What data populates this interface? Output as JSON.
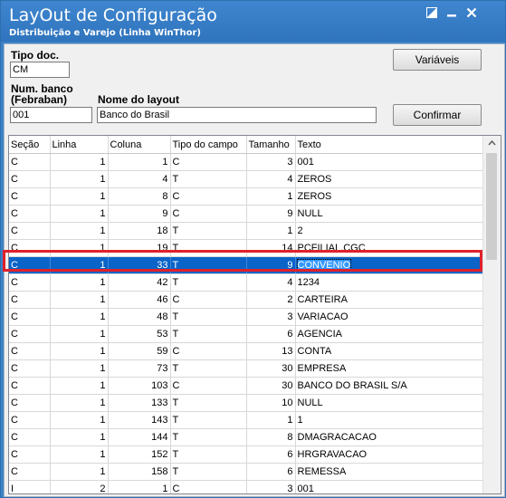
{
  "window": {
    "title": "LayOut de Configuração",
    "subtitle": "Distribuição e Varejo (Linha WinThor)"
  },
  "form": {
    "tipo_doc_label": "Tipo doc.",
    "tipo_doc_value": "CM",
    "num_banco_label_1": "Num. banco",
    "num_banco_label_2": "(Febraban)",
    "num_banco_value": "001",
    "nome_layout_label": "Nome do layout",
    "nome_layout_value": "Banco do Brasil",
    "variaveis_button": "Variáveis",
    "confirmar_button": "Confirmar"
  },
  "grid": {
    "columns": [
      "Seção",
      "Linha",
      "Coluna",
      "Tipo do campo",
      "Tamanho",
      "Texto"
    ],
    "selected_row": 6,
    "rows": [
      [
        "C",
        "1",
        "1",
        "C",
        "3",
        "001"
      ],
      [
        "C",
        "1",
        "4",
        "T",
        "4",
        "ZEROS"
      ],
      [
        "C",
        "1",
        "8",
        "C",
        "1",
        "ZEROS"
      ],
      [
        "C",
        "1",
        "9",
        "C",
        "9",
        "NULL"
      ],
      [
        "C",
        "1",
        "18",
        "T",
        "1",
        "2"
      ],
      [
        "C",
        "1",
        "19",
        "T",
        "14",
        "PCFILIAL.CGC"
      ],
      [
        "C",
        "1",
        "33",
        "T",
        "9",
        "CONVENIO"
      ],
      [
        "C",
        "1",
        "42",
        "T",
        "4",
        "1234"
      ],
      [
        "C",
        "1",
        "46",
        "C",
        "2",
        "CARTEIRA"
      ],
      [
        "C",
        "1",
        "48",
        "T",
        "3",
        "VARIACAO"
      ],
      [
        "C",
        "1",
        "53",
        "T",
        "6",
        "AGENCIA"
      ],
      [
        "C",
        "1",
        "59",
        "C",
        "13",
        "CONTA"
      ],
      [
        "C",
        "1",
        "73",
        "T",
        "30",
        "EMPRESA"
      ],
      [
        "C",
        "1",
        "103",
        "C",
        "30",
        "BANCO DO BRASIL S/A"
      ],
      [
        "C",
        "1",
        "133",
        "T",
        "10",
        "NULL"
      ],
      [
        "C",
        "1",
        "143",
        "T",
        "1",
        "1"
      ],
      [
        "C",
        "1",
        "144",
        "T",
        "8",
        "DMAGRACACAO"
      ],
      [
        "C",
        "1",
        "152",
        "T",
        "6",
        "HRGRAVACAO"
      ],
      [
        "C",
        "1",
        "158",
        "T",
        "6",
        "REMESSA"
      ],
      [
        "I",
        "2",
        "1",
        "C",
        "3",
        "001"
      ]
    ]
  },
  "icons": {
    "edit": "edit-window-icon",
    "minimize": "minimize-icon",
    "close": "close-icon"
  },
  "colors": {
    "titlebar": "#3d82c6",
    "selection": "#0a64c8",
    "highlight_box": "#e0202a"
  }
}
